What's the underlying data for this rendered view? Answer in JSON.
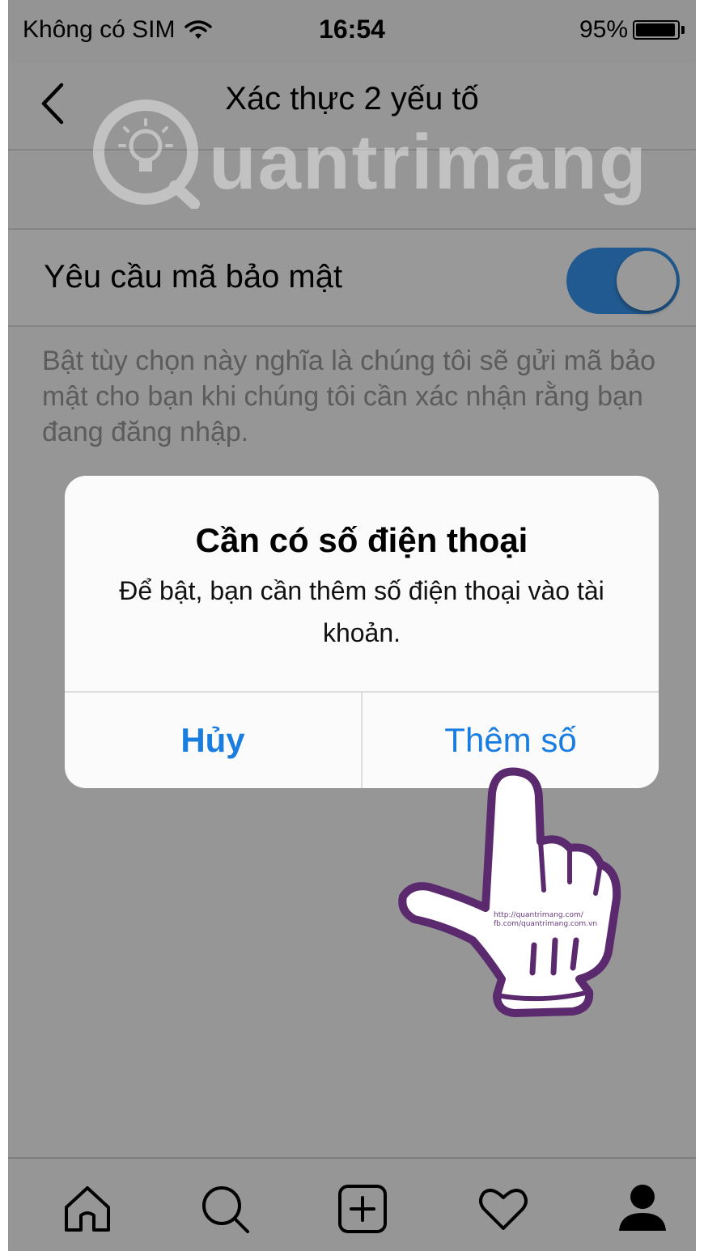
{
  "status_bar": {
    "carrier": "Không có SIM",
    "time": "16:54",
    "battery": "95%",
    "wifi_icon": "wifi-icon",
    "battery_icon": "battery-icon"
  },
  "nav": {
    "title": "Xác thực 2 yếu tố",
    "back_icon": "chevron-left-icon"
  },
  "watermark": {
    "text": "uantrimang",
    "logo_icon": "lightbulb-icon"
  },
  "setting": {
    "label": "Yêu cầu mã bảo mật",
    "toggle_on": true
  },
  "description": "Bật tùy chọn này nghĩa là chúng tôi sẽ gửi mã bảo mật cho bạn khi chúng tôi cần xác nhận rằng bạn đang đăng nhập.",
  "alert": {
    "title": "Cần có số điện thoại",
    "message": "Để bật, bạn cần thêm số điện thoại vào tài khoản.",
    "cancel_label": "Hủy",
    "confirm_label": "Thêm số"
  },
  "hand_tag": {
    "line1": "http://quantrimang.com/",
    "line2": "fb.com/quantrimang.com.vn"
  },
  "tabbar": {
    "items": [
      {
        "name": "home-icon"
      },
      {
        "name": "search-icon"
      },
      {
        "name": "add-post-icon"
      },
      {
        "name": "heart-icon"
      },
      {
        "name": "profile-icon"
      }
    ]
  },
  "colors": {
    "accent": "#3897f0",
    "alert_button": "#1a7ee0",
    "hand_outline": "#5b2a6e"
  }
}
